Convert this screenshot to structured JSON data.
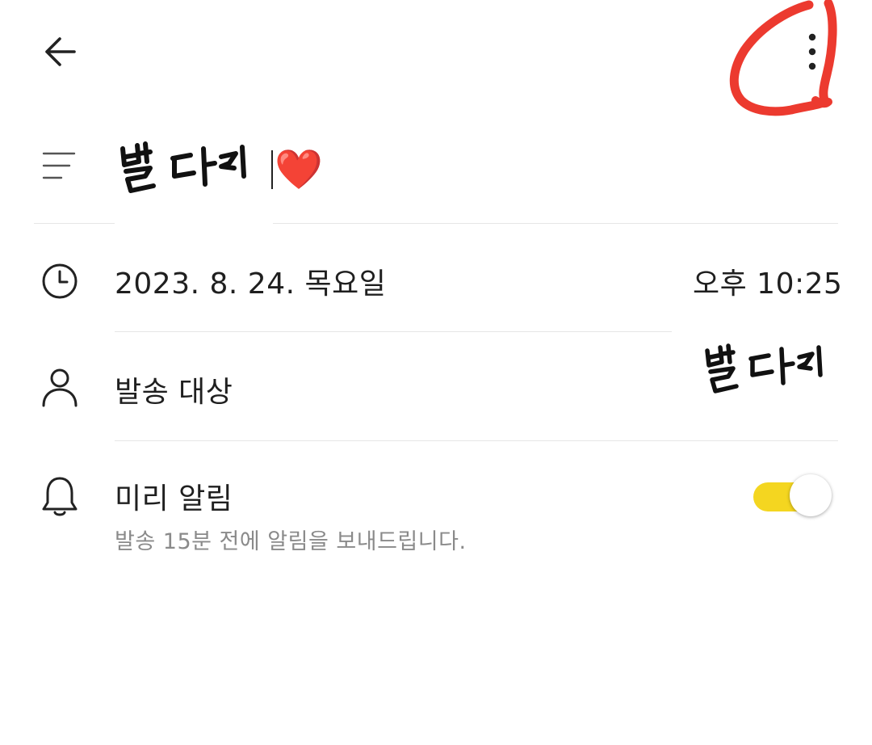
{
  "header": {
    "back_icon": "arrow-left-icon",
    "more_icon": "vertical-dots-icon",
    "annotation_color": "#ec3a2f"
  },
  "memo": {
    "title_handwritten": "별다리",
    "title_emoji": "❤️",
    "icon": "list-lines-icon"
  },
  "schedule": {
    "icon": "clock-icon",
    "date": "2023. 8. 24. 목요일",
    "time": "오후 10:25"
  },
  "target": {
    "icon": "person-icon",
    "label": "발송 대상",
    "value_handwritten": "별다리"
  },
  "reminder": {
    "icon": "bell-icon",
    "label": "미리 알림",
    "description": "발송 15분 전에 알림을 보내드립니다.",
    "enabled": true,
    "toggle_color": "#f4d620"
  }
}
